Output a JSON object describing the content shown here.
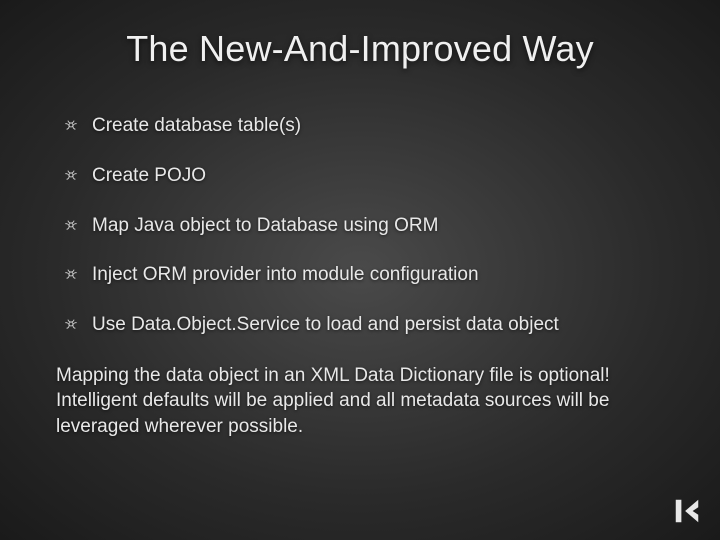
{
  "title": "The New-And-Improved Way",
  "bullets": [
    "Create database table(s)",
    "Create POJO",
    "Map Java object to Database using ORM",
    "Inject ORM provider into module configuration",
    "Use Data.Object.Service to load and persist data object"
  ],
  "paragraph": "Mapping the data object in an XML Data Dictionary file is optional! Intelligent defaults will be applied and all metadata sources will be leveraged wherever possible.",
  "colors": {
    "bullet_icon": "#c8c8c8",
    "logo_fill": "#e8e8e8"
  }
}
